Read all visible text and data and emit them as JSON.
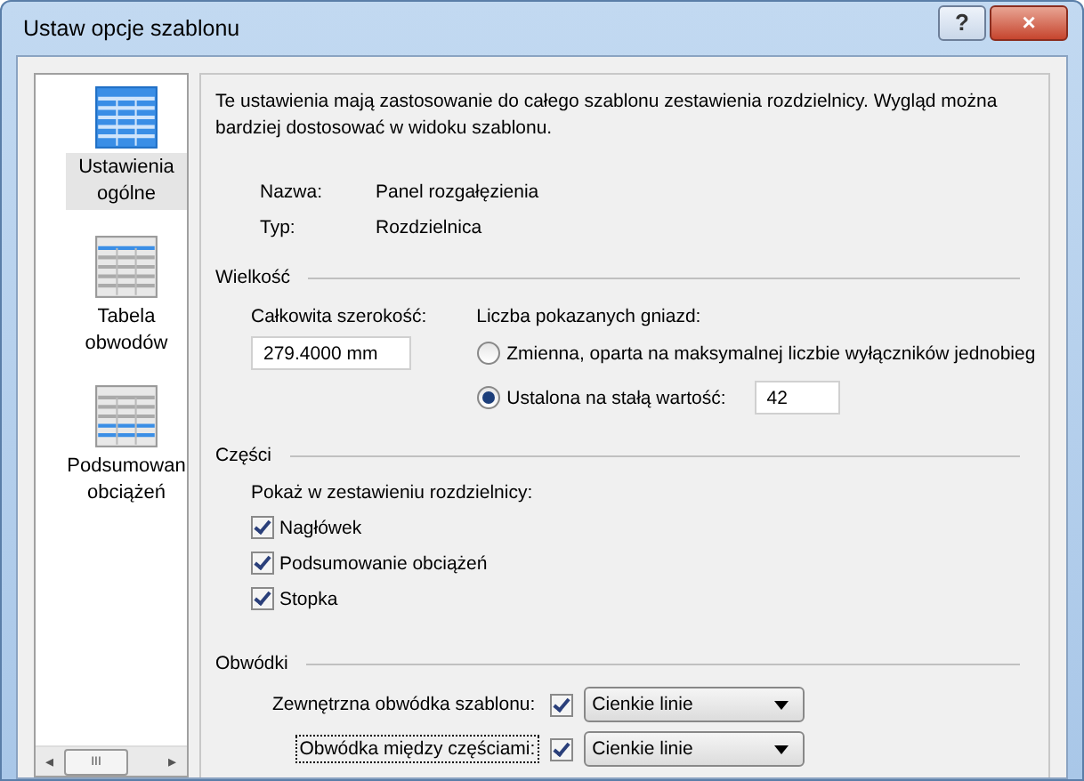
{
  "window": {
    "title": "Ustaw opcje szablonu",
    "buttons": [
      "?",
      "×"
    ]
  },
  "sidebar": {
    "items": [
      {
        "label": "Ustawienia ogólne",
        "selected": true,
        "kind": "general"
      },
      {
        "label": "Tabela obwodów",
        "selected": false,
        "kind": "table"
      },
      {
        "label": "Podsumowan obciążeń",
        "selected": false,
        "kind": "summary"
      }
    ],
    "scrollbar": {
      "left": "◂",
      "thumb": "III",
      "right": "▸"
    }
  },
  "intro": "Te ustawienia mają zastosowanie do całego szablonu zestawienia rozdzielnicy. Wygląd można bardziej dostosować w widoku szablonu.",
  "info": [
    {
      "label": "Nazwa:",
      "value": "Panel rozgałęzienia"
    },
    {
      "label": "Typ:",
      "value": "Rozdzielnica"
    }
  ],
  "size": {
    "heading": "Wielkość",
    "width_label": "Całkowita szerokość:",
    "width_value": "279.4000 mm",
    "slots_label": "Liczba pokazanych gniazd:",
    "options": [
      {
        "label": "Zmienna, oparta na maksymalnej liczbie wyłączników jednobieg",
        "selected": false
      },
      {
        "label": "Ustalona na stałą wartość:",
        "selected": true,
        "value": "42"
      }
    ]
  },
  "parts": {
    "heading": "Części",
    "label": "Pokaż w zestawieniu rozdzielnicy:",
    "items": [
      {
        "label": "Nagłówek",
        "checked": true
      },
      {
        "label": "Podsumowanie obciążeń",
        "checked": true
      },
      {
        "label": "Stopka",
        "checked": true
      }
    ]
  },
  "borders": {
    "heading": "Obwódki",
    "rows": [
      {
        "label": "Zewnętrzna obwódka szablonu:",
        "checked": true,
        "focused": false,
        "value": "Cienkie linie"
      },
      {
        "label": "Obwódka między częściami:",
        "checked": true,
        "focused": true,
        "value": "Cienkie linie"
      }
    ]
  }
}
